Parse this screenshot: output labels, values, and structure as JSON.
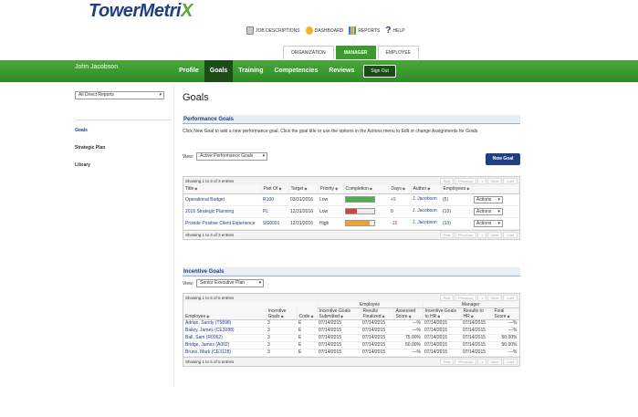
{
  "header": {
    "logo_main": "TowerMetri",
    "logo_x": "X",
    "links": [
      "JOB DESCRIPTIONS",
      "DASHBOARD",
      "REPORTS",
      "HELP"
    ],
    "role_tabs": [
      "ORGANIZATION",
      "MANAGER",
      "EMPLOYEE"
    ],
    "active_role": "MANAGER",
    "user": "John Jacobson",
    "nav_tabs": [
      "Profile",
      "Goals",
      "Training",
      "Competencies",
      "Reviews"
    ],
    "active_nav": "Goals",
    "signout": "Sign Out"
  },
  "sidebar": {
    "report_select": "All Direct Reports",
    "items": [
      "Goals",
      "Strategic Plan",
      "Library"
    ],
    "active": "Goals"
  },
  "main": {
    "title": "Goals",
    "performance": {
      "header": "Performance Goals",
      "desc": "Click New Goal to add a new performance goal. Click the goal title or use the options in the Actions menu to Edit or change Assignments for Goals",
      "view_label": "View:",
      "view_value": "Active Performance Goals",
      "new_goal": "New Goal",
      "info_top": "Showing 1 to 3 of 3 entries",
      "info_bottom": "Showing 1 to 3 of 3 entries",
      "pager": [
        "First",
        "Previous",
        "1",
        "Next",
        "Last"
      ],
      "columns": [
        "Title",
        "Part Of",
        "Target",
        "Priority",
        "Completion",
        "Days",
        "Author",
        "Employees"
      ],
      "rows": [
        {
          "title": "Operational Budget",
          "part_of": "R100",
          "target": "03/31/2016",
          "priority": "Low",
          "completion": 1.0,
          "color": "#4cae4c",
          "days": "+9",
          "author": "J. Jacobson",
          "employees": "(5)",
          "action": "Actions"
        },
        {
          "title": "2016 Strategic Planning",
          "part_of": "PL",
          "target": "12/31/2016",
          "priority": "Low",
          "completion": 0.4,
          "color": "#d9403a",
          "days": "0",
          "author": "J. Jacobson",
          "employees": "(10)",
          "action": "Actions"
        },
        {
          "title": "Provide Positive Client Experience",
          "part_of": "SG0001",
          "target": "12/31/2016",
          "priority": "High",
          "completion": 0.85,
          "color": "#f0a030",
          "days": "-15",
          "author": "J. Jacobson",
          "employees": "(10)",
          "action": "Actions"
        }
      ]
    },
    "incentive": {
      "header": "Incentive Goals",
      "view_label": "View:",
      "view_value": "Senior Executive Plan",
      "info_top": "Showing 1 to 5 of 5 entries",
      "info_bottom": "Showing 1 to 5 of 5 entries",
      "pager": [
        "First",
        "Previous",
        "1",
        "Next",
        "Last"
      ],
      "group_employee": "Employee",
      "group_manager": "Manager",
      "columns": [
        "Employee",
        "Incentive Goals",
        "Code",
        "Incentive Goals Submitted",
        "Results Finalized",
        "Assessed Score",
        "Incentive Goals to HR",
        "Results to HR",
        "Final Score"
      ],
      "rows": [
        [
          "Adrian, Sandy (T5898)",
          "3",
          "E",
          "07/14/2015",
          "07/14/2015",
          "—%",
          "07/14/2015",
          "07/14/2015",
          "—%"
        ],
        [
          "Bailey, James (CE3088)",
          "3",
          "E",
          "07/14/2015",
          "07/14/2015",
          "—%",
          "07/14/2015",
          "07/14/2015",
          "—%"
        ],
        [
          "Ball, Sam (R0062)",
          "3",
          "E",
          "07/14/2015",
          "07/14/2015",
          "75.00%",
          "07/14/2015",
          "07/14/2015",
          "50.00%"
        ],
        [
          "Bridge, James (A002)",
          "3",
          "E",
          "07/14/2015",
          "07/14/2015",
          "50.00%",
          "07/14/2015",
          "07/14/2015",
          "50.00%"
        ],
        [
          "Bruno, Mark (CE3128)",
          "3",
          "E",
          "07/14/2015",
          "07/14/2015",
          "—%",
          "07/14/2015",
          "07/14/2015",
          "—%"
        ]
      ]
    }
  }
}
